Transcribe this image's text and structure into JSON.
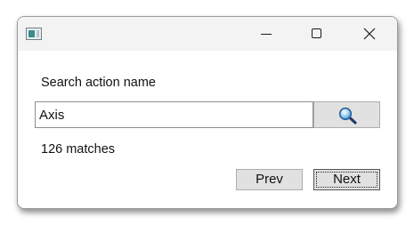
{
  "window": {
    "controls": {
      "minimize_icon": "minimize-icon",
      "maximize_icon": "maximize-icon",
      "close_icon": "close-icon"
    }
  },
  "search": {
    "label": "Search action name",
    "value": "Axis",
    "button_icon": "magnifier-icon"
  },
  "results": {
    "status": "126 matches"
  },
  "buttons": {
    "prev": "Prev",
    "next": "Next"
  }
}
